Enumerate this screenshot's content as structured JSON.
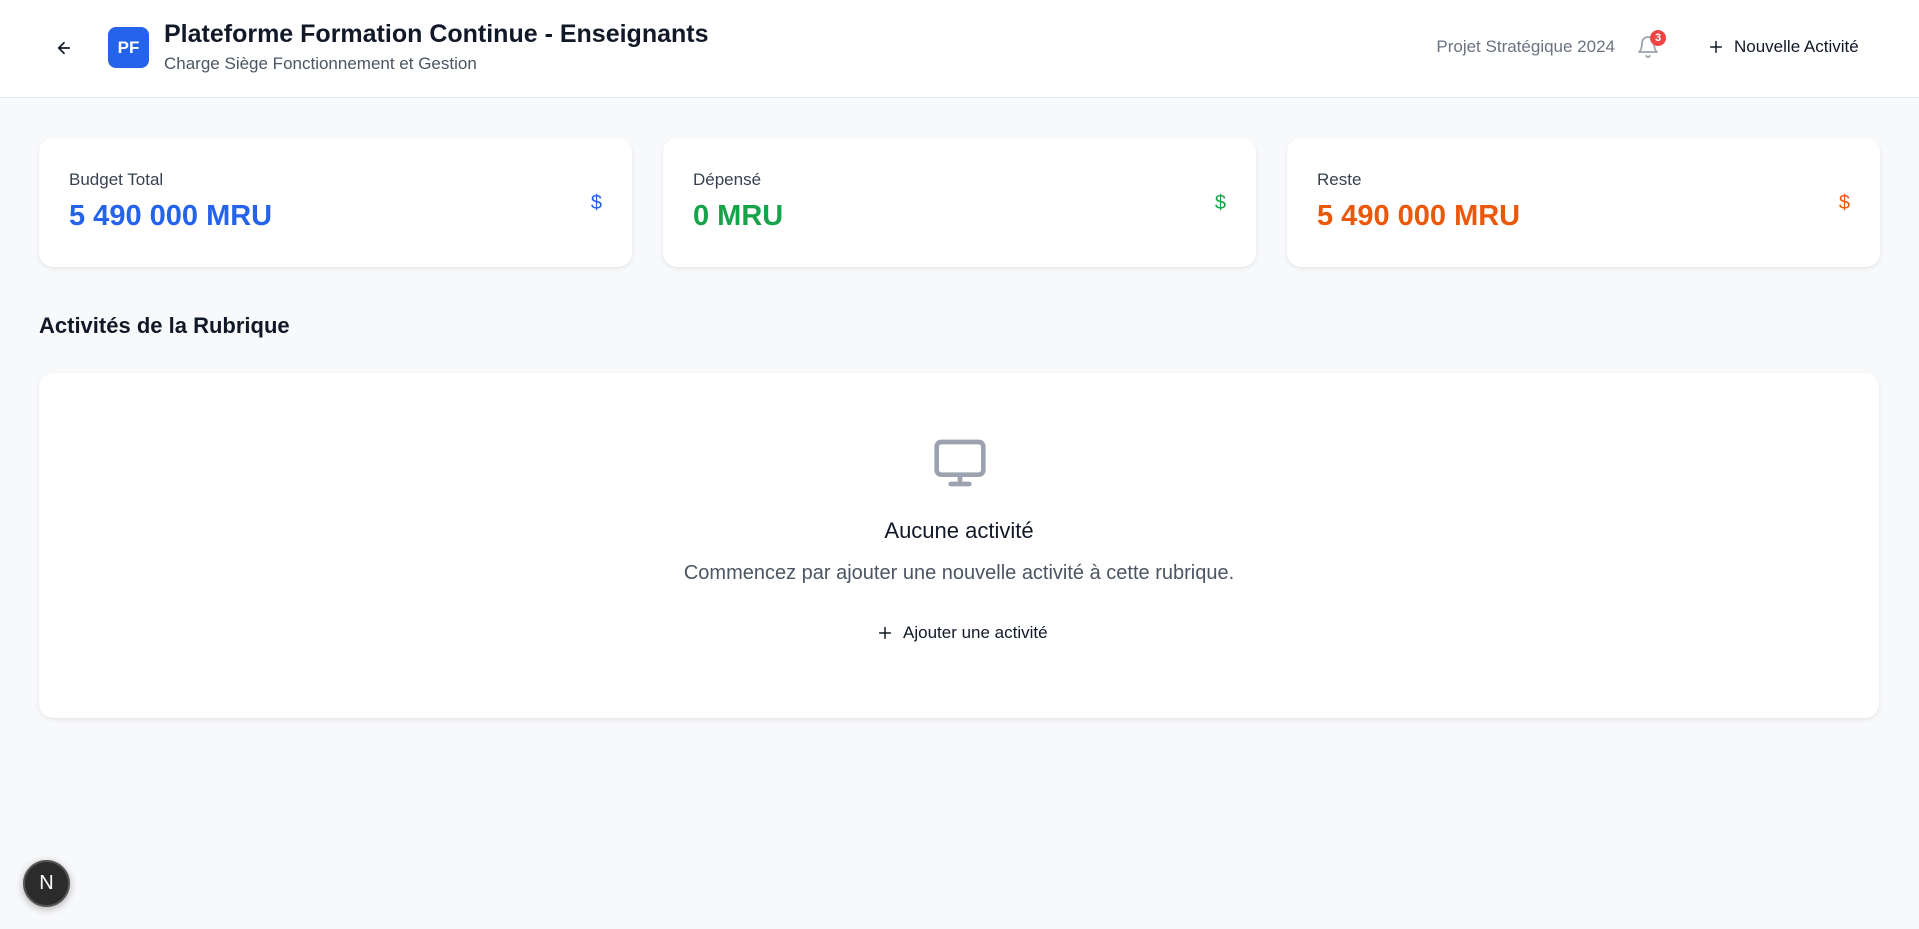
{
  "header": {
    "logo_text": "PF",
    "title": "Plateforme Formation Continue - Enseignants",
    "subtitle": "Charge Siège Fonctionnement et Gestion",
    "project_label": "Projet Stratégique 2024",
    "notification_count": "3",
    "new_activity_label": "Nouvelle Activité"
  },
  "stats": [
    {
      "label": "Budget Total",
      "value": "5 490 000 MRU",
      "icon": "$",
      "color": "#2563eb"
    },
    {
      "label": "Dépensé",
      "value": "0 MRU",
      "icon": "$",
      "color": "#16a34a"
    },
    {
      "label": "Reste",
      "value": "5 490 000 MRU",
      "icon": "$",
      "color": "#ea580c"
    }
  ],
  "section": {
    "title": "Activités de la Rubrique"
  },
  "empty_state": {
    "icon": "monitor-icon",
    "title": "Aucune activité",
    "description": "Commencez par ajouter une nouvelle activité à cette rubrique.",
    "button_label": "Ajouter une activité"
  },
  "dev_badge": {
    "letter": "N"
  }
}
